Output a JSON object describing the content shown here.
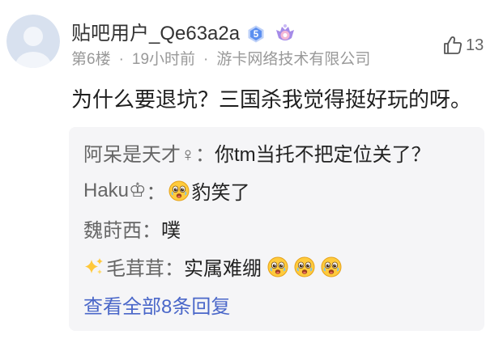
{
  "post": {
    "author": {
      "avatar_icon": "default-avatar-icon",
      "name": "贴吧用户_Qe63a2a",
      "level_badge": "5",
      "badge_icons": [
        "level-badge-icon",
        "purple-badge-icon"
      ]
    },
    "meta": {
      "floor": "第6楼",
      "separator": "·",
      "time": "19小时前",
      "source": "游卡网络技术有限公司"
    },
    "like": {
      "icon": "thumbs-up-icon",
      "count": "13"
    },
    "content": "为什么要退坑？三国杀我觉得挺好玩的呀。"
  },
  "replies": {
    "colon": "：",
    "items": [
      {
        "name": "阿呆是天才♀",
        "text": "你tm当托不把定位关了？"
      },
      {
        "name": "Haku♔",
        "emojis_before": [
          "surprised-cry-emoji-icon"
        ],
        "text": "豹笑了"
      },
      {
        "name": "魏莳西",
        "text": "噗"
      },
      {
        "name_icon": "sparkles-icon",
        "name": "毛茸茸",
        "text": "实属难绷",
        "emojis_after": [
          "surprised-cry-emoji-icon",
          "surprised-cry-emoji-icon",
          "surprised-cry-emoji-icon"
        ]
      }
    ],
    "view_all": "查看全部8条回复"
  },
  "colors": {
    "author": "#333333",
    "meta": "#999999",
    "content": "#1f1f1f",
    "reply_name": "#666666",
    "reply_text": "#222222",
    "reply_bg": "#f5f5f7",
    "link": "#4a67c9",
    "level_badge": "#5b8ff0",
    "member_badge": "#a58be8"
  }
}
